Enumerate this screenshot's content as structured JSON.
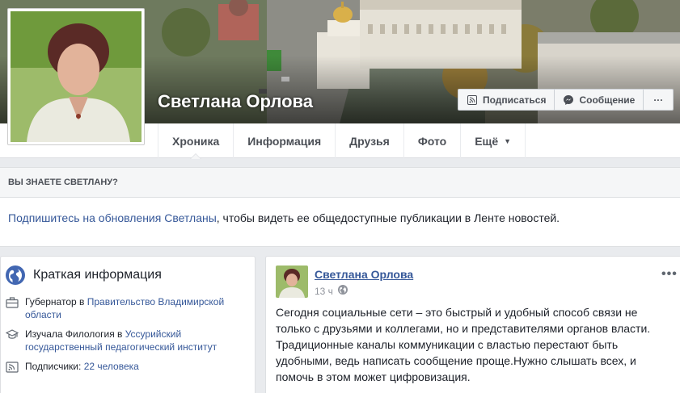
{
  "profile": {
    "name": "Светлана Орлова"
  },
  "cover_actions": {
    "subscribe_label": "Подписаться",
    "message_label": "Сообщение",
    "more_label": "···"
  },
  "nav": {
    "tabs": [
      {
        "label": "Хроника",
        "active": true
      },
      {
        "label": "Информация"
      },
      {
        "label": "Друзья"
      },
      {
        "label": "Фото"
      },
      {
        "label": "Ещё"
      }
    ],
    "dropdown_arrow": "▼"
  },
  "know": {
    "header": "ВЫ ЗНАЕТЕ СВЕТЛАНУ?",
    "link_text": "Подпишитесь на обновления Светланы",
    "rest_text": ", чтобы видеть ее общедоступные публикации в Ленте новостей."
  },
  "intro": {
    "title": "Краткая информация",
    "rows": [
      {
        "icon": "briefcase-icon",
        "prefix": "Губернатор в ",
        "link": "Правительство Владимирской области"
      },
      {
        "icon": "graduation-cap-icon",
        "prefix": "Изучала Филология в ",
        "link": "Уссурийский государственный педагогический институт"
      },
      {
        "icon": "rss-icon",
        "prefix": "Подписчики: ",
        "link": "22 человека"
      }
    ]
  },
  "post": {
    "author": "Светлана Орлова",
    "time": "13 ч",
    "more_label": "•••",
    "text": "Сегодня социальные сети – это быстрый и удобный способ связи не только с друзьями и коллегами, но и представителями органов власти. Традиционные каналы коммуникации с властью перестают быть удобными, ведь написать сообщение проще.Нужно слышать всех, и помочь в этом может цифровизация."
  },
  "colors": {
    "link": "#365899",
    "background": "#e9ebee",
    "text": "#1d2129",
    "muted": "#90949c"
  }
}
